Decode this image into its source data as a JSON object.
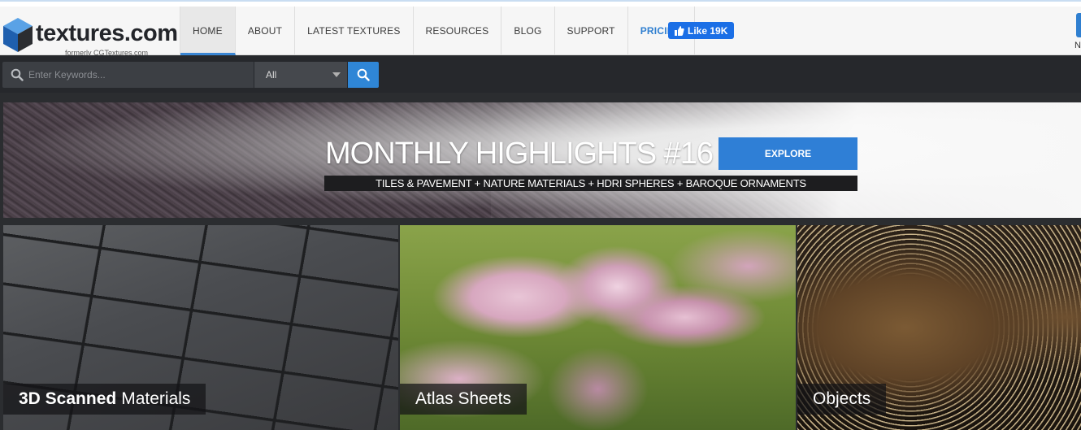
{
  "header": {
    "logo_text": "textures.com",
    "logo_sub": "formerly CGTextures.com",
    "nav": [
      {
        "label": "HOME"
      },
      {
        "label": "ABOUT"
      },
      {
        "label": "LATEST TEXTURES"
      },
      {
        "label": "RESOURCES"
      },
      {
        "label": "BLOG"
      },
      {
        "label": "SUPPORT"
      },
      {
        "label": "PRICING"
      }
    ],
    "fb_like": "Like 19K",
    "right_text": "N"
  },
  "search": {
    "placeholder": "Enter Keywords...",
    "category_selected": "All"
  },
  "banner": {
    "title": "MONTHLY HIGHLIGHTS #16",
    "subtitle": "TILES & PAVEMENT + NATURE MATERIALS + HDRI SPHERES + BAROQUE ORNAMENTS",
    "explore_label": "EXPLORE"
  },
  "tiles": [
    {
      "label_bold": "3D Scanned",
      "label_rest": "Materials"
    },
    {
      "label_bold": "",
      "label_rest": "Atlas Sheets"
    },
    {
      "label_bold": "",
      "label_rest": "Objects"
    }
  ],
  "colors": {
    "accent": "#2f7fd6",
    "header_bg": "#f6f6f6",
    "dark_bar": "#26282c"
  }
}
